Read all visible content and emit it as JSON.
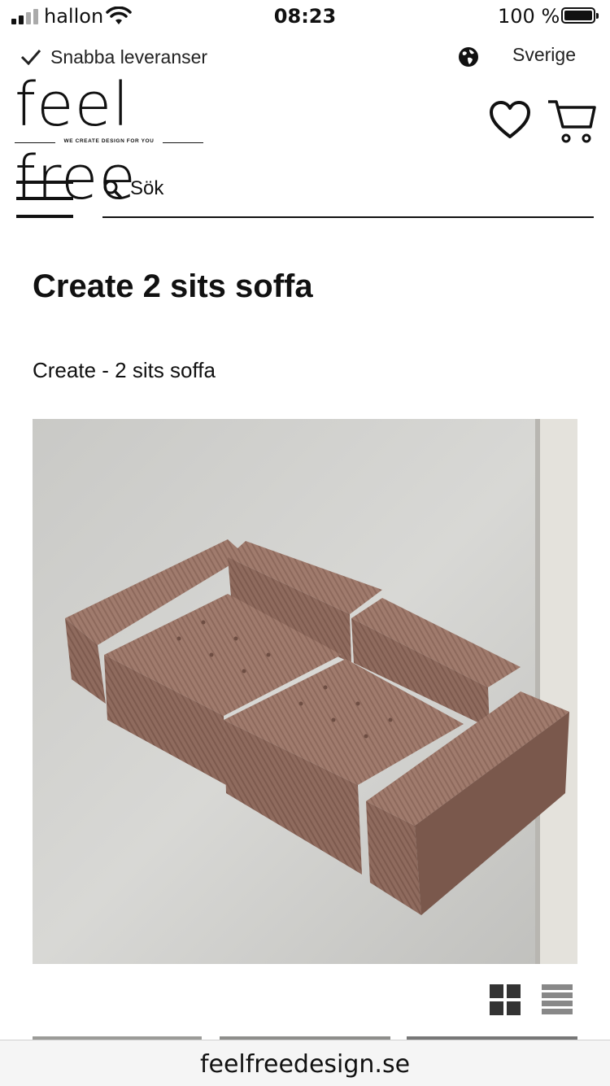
{
  "status_bar": {
    "carrier": "hallon",
    "time": "08:23",
    "battery": "100 %"
  },
  "topbar": {
    "fast_delivery": "Snabba leveranser",
    "country": "Sverige"
  },
  "logo": {
    "name": "feel free",
    "tagline": "WE CREATE DESIGN FOR YOU"
  },
  "search": {
    "label": "Sök"
  },
  "product": {
    "title": "Create 2 sits soffa",
    "subtitle": "Create - 2 sits soffa",
    "image_description": "Brown corduroy modular 2-seat sofa on concrete floor"
  },
  "view_toggle": {
    "grid_icon": "grid-icon",
    "list_icon": "list-icon"
  },
  "browser": {
    "url": "feelfreedesign.se"
  }
}
